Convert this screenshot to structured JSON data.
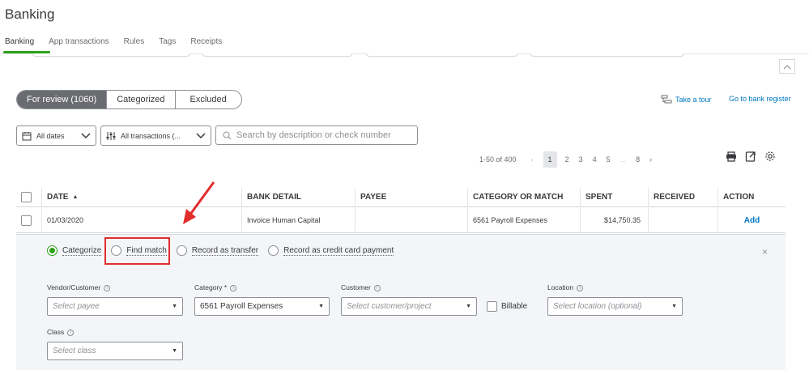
{
  "page_title": "Banking",
  "tabs": [
    "Banking",
    "App transactions",
    "Rules",
    "Tags",
    "Receipts"
  ],
  "review_tabs": [
    "For review (1060)",
    "Categorized",
    "Excluded"
  ],
  "links": {
    "tour": "Take a tour",
    "goto": "Go to bank register"
  },
  "filters": {
    "dates": "All dates",
    "transactions": "All transactions (...",
    "search_placeholder": "Search by description or check number"
  },
  "pager": {
    "range": "1-50 of 400",
    "pages": [
      "1",
      "2",
      "3",
      "4",
      "5",
      "...",
      "8"
    ],
    "current": "1"
  },
  "table": {
    "headers": [
      "DATE",
      "BANK DETAIL",
      "PAYEE",
      "CATEGORY OR MATCH",
      "SPENT",
      "RECEIVED",
      "ACTION"
    ],
    "row": {
      "date": "01/03/2020",
      "bank_detail": "Invoice Human Capital",
      "payee": "",
      "category": "6561 Payroll Expenses",
      "spent": "$14,750.35",
      "received": "",
      "action": "Add"
    }
  },
  "panel": {
    "radios": [
      "Categorize",
      "Find match",
      "Record as transfer",
      "Record as credit card payment"
    ],
    "selected_radio": "Categorize",
    "vendor_label": "Vendor/Customer",
    "vendor_placeholder": "Select payee",
    "category_label": "Category *",
    "category_value": "6561 Payroll Expenses",
    "customer_label": "Customer",
    "customer_placeholder": "Select customer/project",
    "billable_label": "Billable",
    "location_label": "Location",
    "location_placeholder": "Select location (optional)",
    "class_label": "Class",
    "class_placeholder": "Select class"
  },
  "colors": {
    "accent": "#2ca01c",
    "link": "#0077c5",
    "highlight": "#e22d2d"
  }
}
